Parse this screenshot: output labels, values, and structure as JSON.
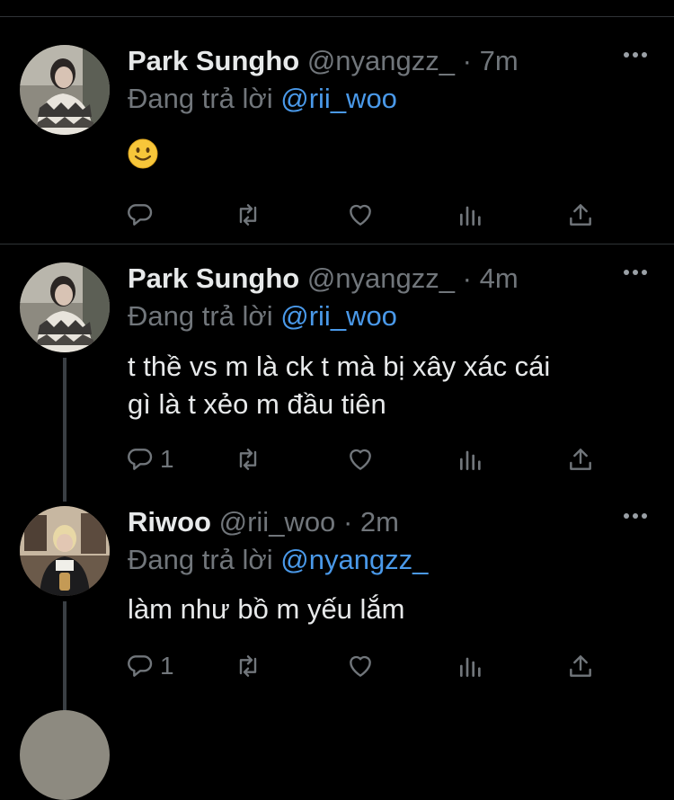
{
  "tweets": [
    {
      "name": "Park Sungho",
      "handle": "@nyangzz_",
      "time": "· 7m",
      "reply_label": "Đang trả lời",
      "reply_to": "@rii_woo",
      "text": "",
      "emoji": "slightly-smiling-face",
      "reply_count": ""
    },
    {
      "name": "Park Sungho",
      "handle": "@nyangzz_",
      "time": "· 4m",
      "reply_label": "Đang trả lời",
      "reply_to": "@rii_woo",
      "text_line1": "t thề vs m là ck t mà bị xây xác cái",
      "text_line2": "gì là t xẻo m đầu tiên",
      "reply_count": "1"
    },
    {
      "name": "Riwoo",
      "handle": "@rii_woo",
      "time": "· 2m",
      "reply_label": "Đang trả lời",
      "reply_to": "@nyangzz_",
      "text": "làm như bồ m yếu lắm",
      "reply_count": "1"
    }
  ],
  "colors": {
    "background": "#000000",
    "accent": "#4a99e9",
    "muted": "#71767b",
    "text": "#e7e9ea"
  }
}
